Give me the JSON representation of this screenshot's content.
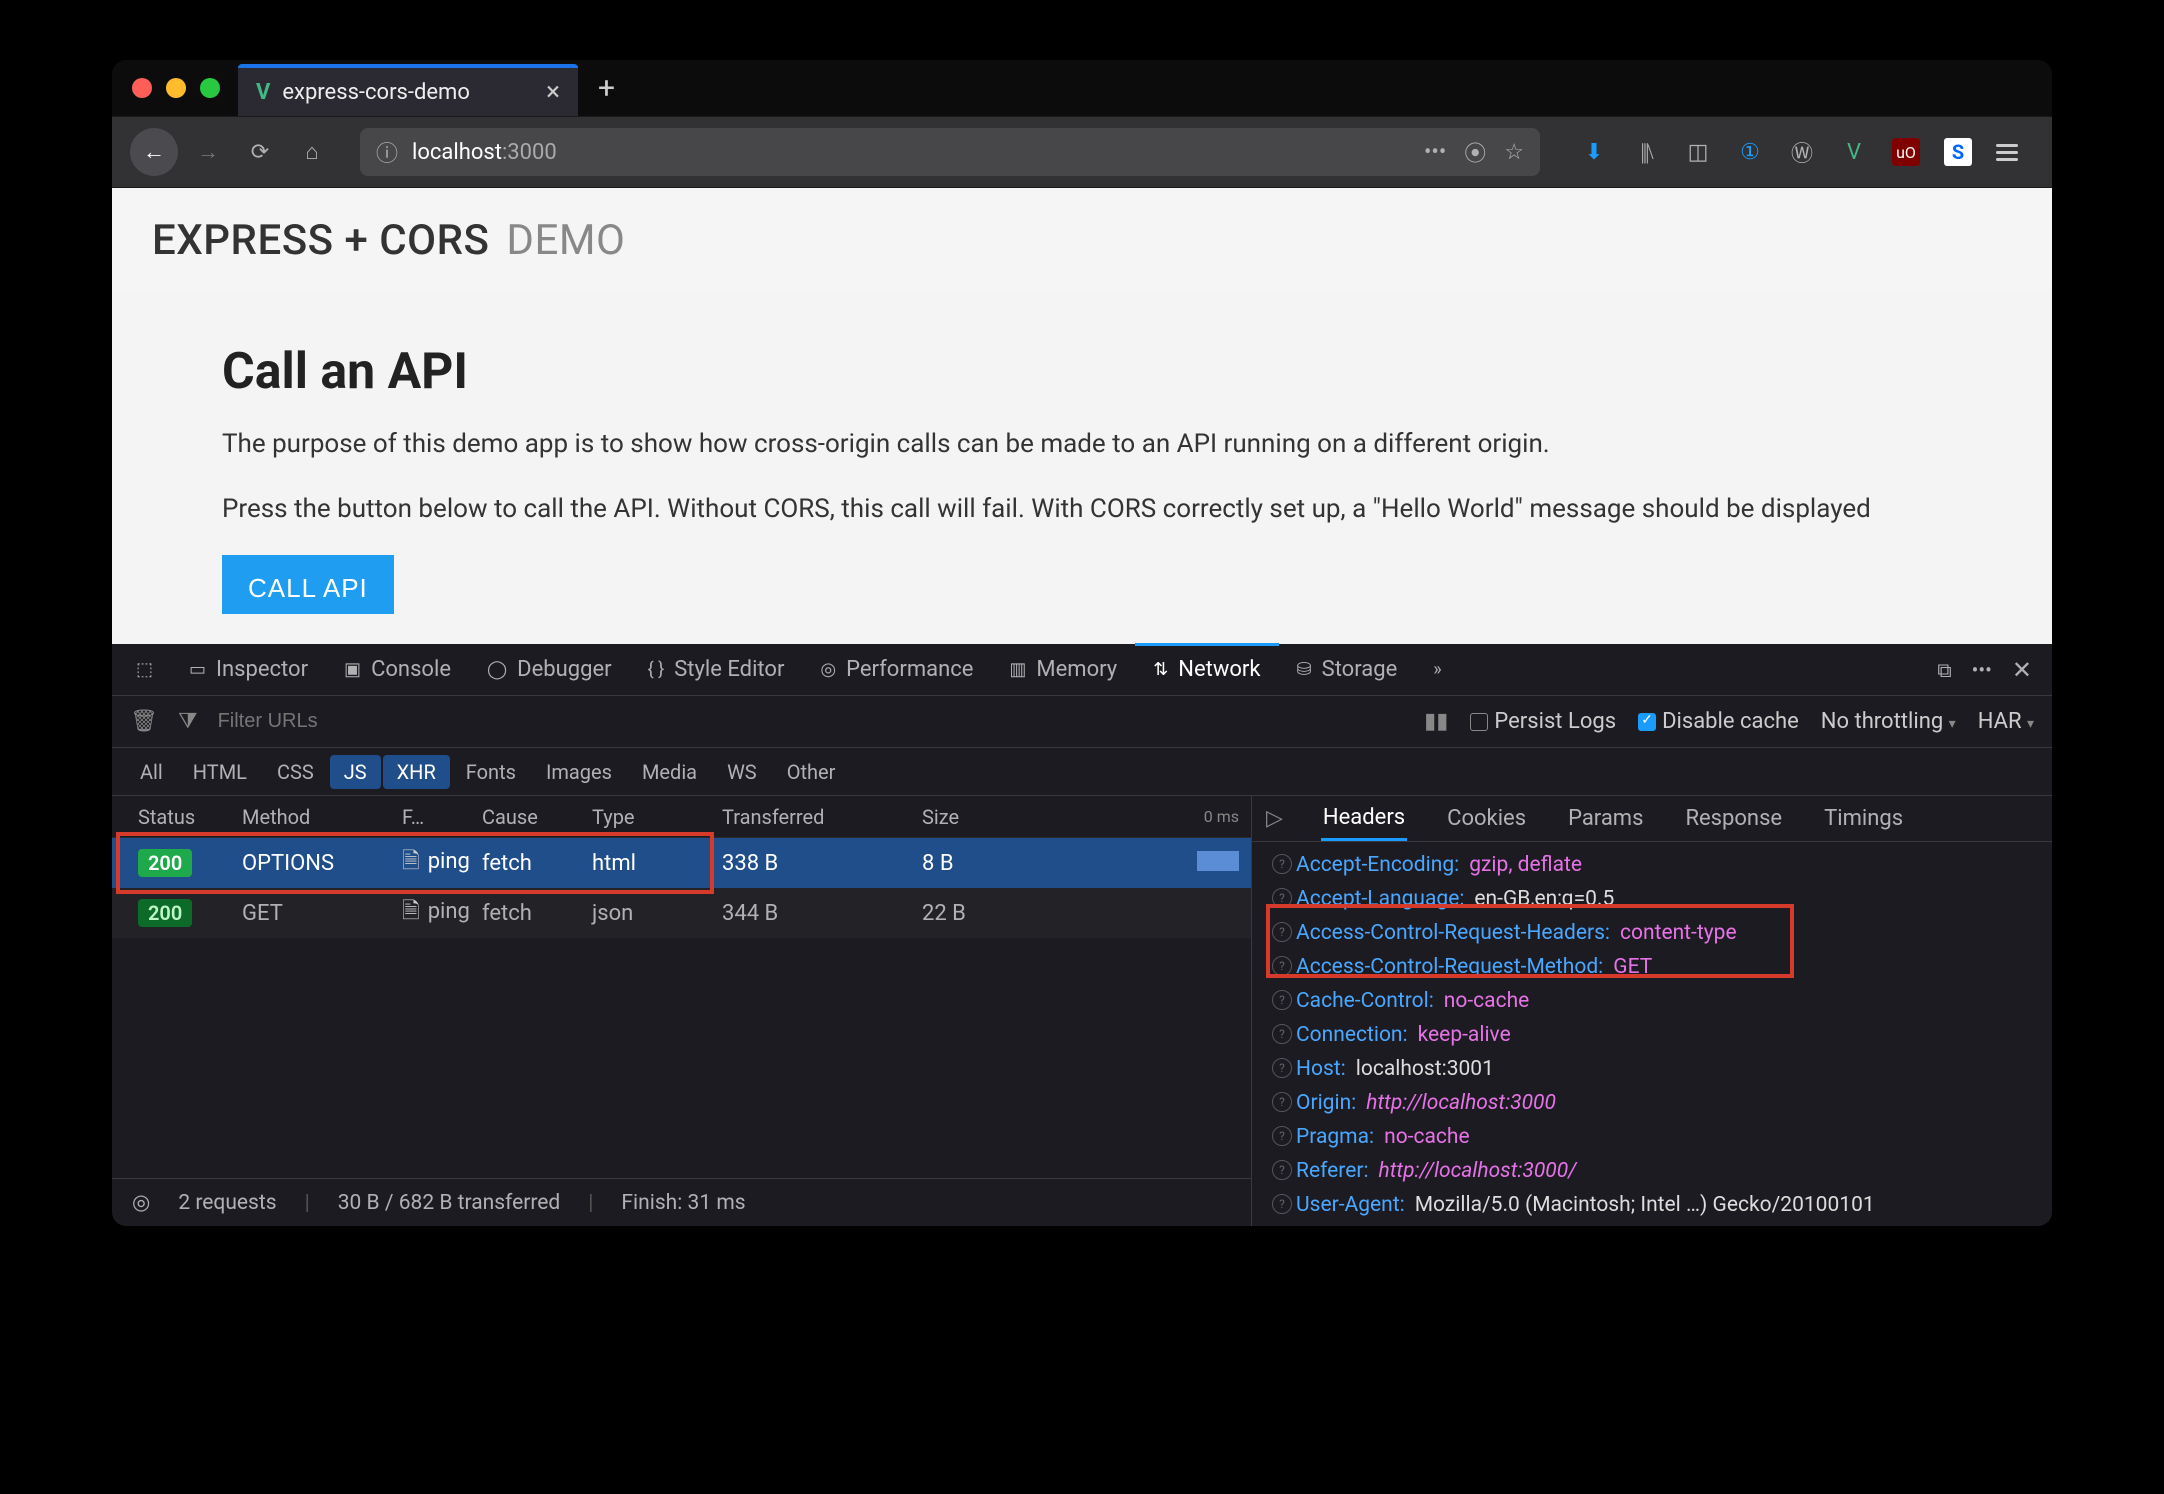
{
  "tab": {
    "title": "express-cors-demo"
  },
  "url": {
    "info_icon": "ⓘ",
    "host": "localhost",
    "port": ":3000"
  },
  "banner": {
    "title_strong": "EXPRESS + CORS",
    "title_light": "DEMO"
  },
  "page": {
    "heading": "Call an API",
    "p1": "The purpose of this demo app is to show how cross-origin calls can be made to an API running on a different origin.",
    "p2": "Press the button below to call the API. Without CORS, this call will fail. With CORS correctly set up, a \"Hello World\" message should be displayed",
    "button": "CALL API"
  },
  "devtools_tabs": {
    "inspector": "Inspector",
    "console": "Console",
    "debugger": "Debugger",
    "style": "Style Editor",
    "performance": "Performance",
    "memory": "Memory",
    "network": "Network",
    "storage": "Storage"
  },
  "toolbar": {
    "filter_placeholder": "Filter URLs",
    "persist": "Persist Logs",
    "disable_cache": "Disable cache",
    "throttling": "No throttling",
    "har": "HAR"
  },
  "filters": {
    "all": "All",
    "html": "HTML",
    "css": "CSS",
    "js": "JS",
    "xhr": "XHR",
    "fonts": "Fonts",
    "images": "Images",
    "media": "Media",
    "ws": "WS",
    "other": "Other"
  },
  "columns": {
    "status": "Status",
    "method": "Method",
    "file": "F…",
    "cause": "Cause",
    "type": "Type",
    "transferred": "Transferred",
    "size": "Size",
    "timeline": "0 ms"
  },
  "requests": [
    {
      "status": "200",
      "method": "OPTIONS",
      "file": "ping",
      "cause": "fetch",
      "type": "html",
      "transferred": "338 B",
      "size": "8 B",
      "selected": true
    },
    {
      "status": "200",
      "method": "GET",
      "file": "ping",
      "cause": "fetch",
      "type": "json",
      "transferred": "344 B",
      "size": "22 B",
      "selected": false
    }
  ],
  "detail_tabs": {
    "headers": "Headers",
    "cookies": "Cookies",
    "params": "Params",
    "response": "Response",
    "timings": "Timings"
  },
  "headers": [
    {
      "name": "Accept-Encoding:",
      "value": "gzip, deflate"
    },
    {
      "name": "Accept-Language:",
      "value": "en-GB,en;q=0.5"
    },
    {
      "name": "Access-Control-Request-Headers:",
      "value": "content-type"
    },
    {
      "name": "Access-Control-Request-Method:",
      "value": "GET"
    },
    {
      "name": "Cache-Control:",
      "value": "no-cache"
    },
    {
      "name": "Connection:",
      "value": "keep-alive"
    },
    {
      "name": "Host:",
      "value": "localhost:3001",
      "white": true
    },
    {
      "name": "Origin:",
      "value": "http://localhost:3000",
      "italic": true
    },
    {
      "name": "Pragma:",
      "value": "no-cache"
    },
    {
      "name": "Referer:",
      "value": "http://localhost:3000/",
      "italic": true
    },
    {
      "name": "User-Agent:",
      "value": "Mozilla/5.0 (Macintosh; Intel …) Gecko/20100101",
      "white": true
    }
  ],
  "status": {
    "requests": "2 requests",
    "transfer": "30 B / 682 B transferred",
    "finish": "Finish: 31 ms"
  }
}
